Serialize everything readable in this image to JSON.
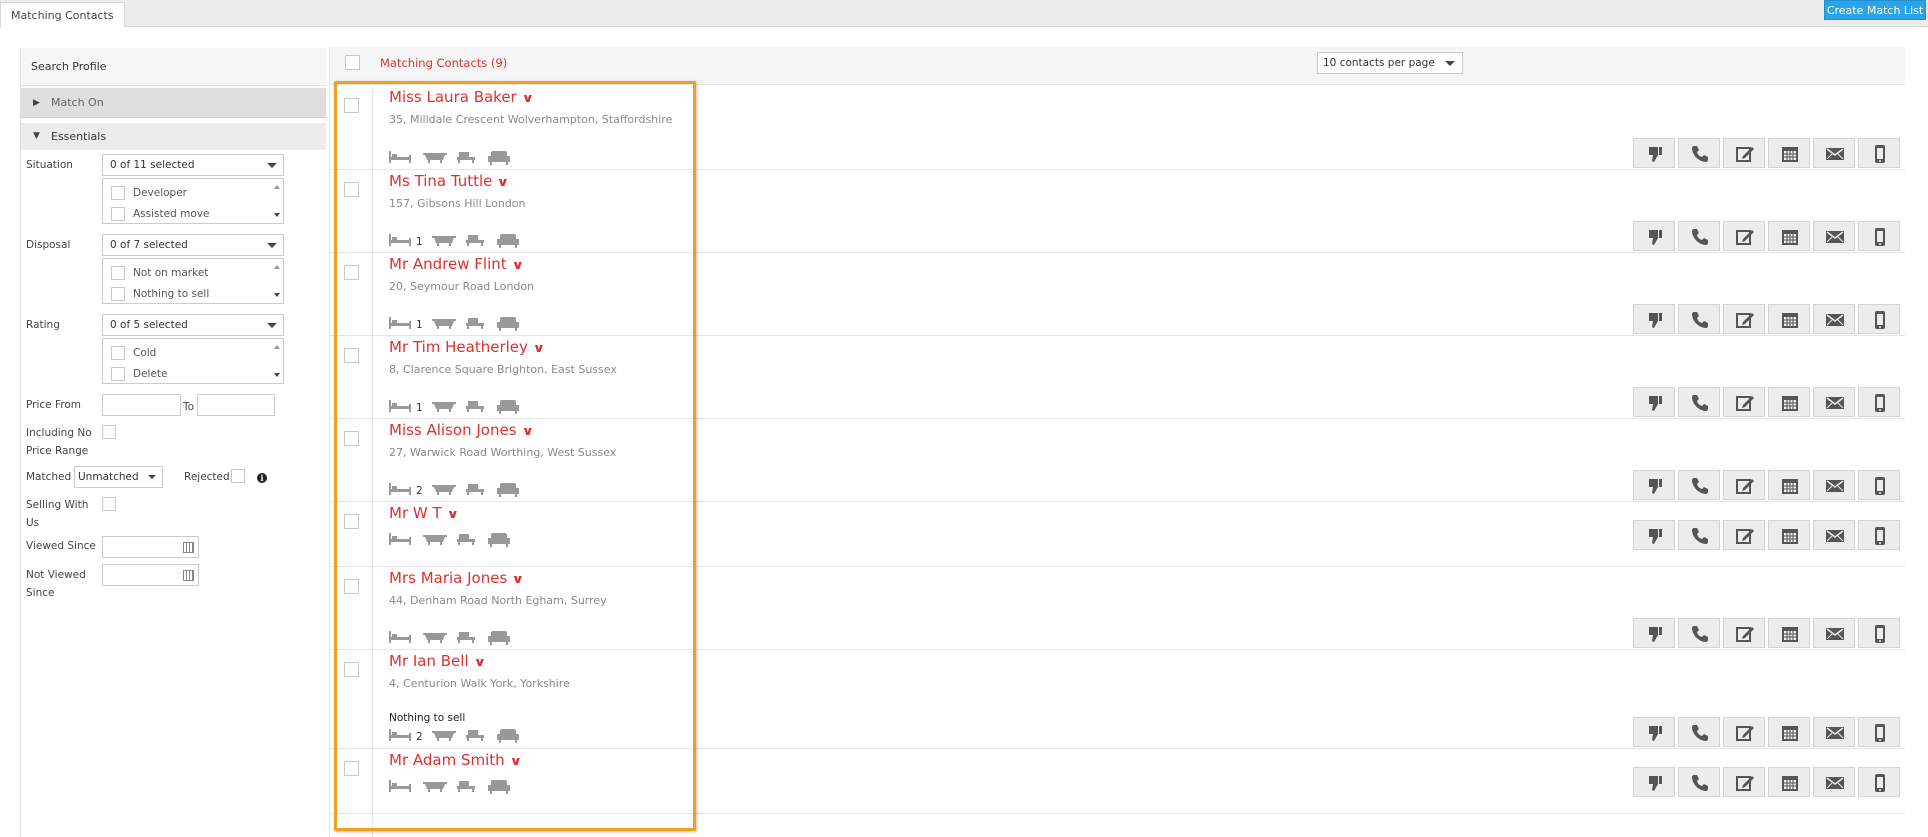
{
  "tab": {
    "label": "Matching Contacts"
  },
  "create_button": {
    "label": "Create Match List"
  },
  "panel": {
    "title": "Search Profile",
    "match_on": "Match On",
    "essentials": "Essentials",
    "situation": {
      "label": "Situation",
      "selected": "0 of 11 selected",
      "options": [
        "Developer",
        "Assisted move"
      ]
    },
    "disposal": {
      "label": "Disposal",
      "selected": "0 of 7 selected",
      "options": [
        "Not on market",
        "Nothing to sell"
      ]
    },
    "rating": {
      "label": "Rating",
      "selected": "0 of 5 selected",
      "options": [
        "Cold",
        "Delete"
      ]
    },
    "price_from": "Price From",
    "price_to": "To",
    "including_no_price_1": "Including No",
    "including_no_price_2": "Price Range",
    "matched": {
      "label": "Matched",
      "value": "Unmatched"
    },
    "rejected": "Rejected",
    "selling_with_us_1": "Selling With",
    "selling_with_us_2": "Us",
    "viewed_since": "Viewed Since",
    "not_viewed_since_1": "Not Viewed",
    "not_viewed_since_2": "Since"
  },
  "results": {
    "title": "Matching Contacts (9)",
    "per_page": "10 contacts per page",
    "contacts": [
      {
        "name": "Miss Laura Baker",
        "address": "35, Milldale Crescent Wolverhampton, Staffordshire",
        "beds": "",
        "note": ""
      },
      {
        "name": "Ms Tina Tuttle",
        "address": "157, Gibsons Hill London",
        "beds": "1",
        "note": ""
      },
      {
        "name": "Mr Andrew Flint",
        "address": "20, Seymour Road London",
        "beds": "1",
        "note": ""
      },
      {
        "name": "Mr Tim Heatherley",
        "address": "8, Clarence Square Brighton, East Sussex",
        "beds": "1",
        "note": ""
      },
      {
        "name": "Miss Alison Jones",
        "address": "27, Warwick Road Worthing, West Sussex",
        "beds": "2",
        "note": ""
      },
      {
        "name": "Mr W T",
        "address": "",
        "beds": "",
        "note": ""
      },
      {
        "name": "Mrs Maria Jones",
        "address": "44, Denham Road North Egham, Surrey",
        "beds": "",
        "note": ""
      },
      {
        "name": "Mr Ian Bell",
        "address": "4, Centurion Walk York, Yorkshire",
        "beds": "2",
        "note": "Nothing to sell"
      },
      {
        "name": "Mr Adam Smith",
        "address": "",
        "beds": "",
        "note": ""
      }
    ],
    "action_icons": [
      "thumbs-down-icon",
      "phone-icon",
      "edit-icon",
      "calendar-icon",
      "email-icon",
      "mobile-icon"
    ]
  },
  "colors": {
    "accent_red": "#e03030",
    "highlight": "#f0a020",
    "button_blue": "#2aa3e8"
  }
}
